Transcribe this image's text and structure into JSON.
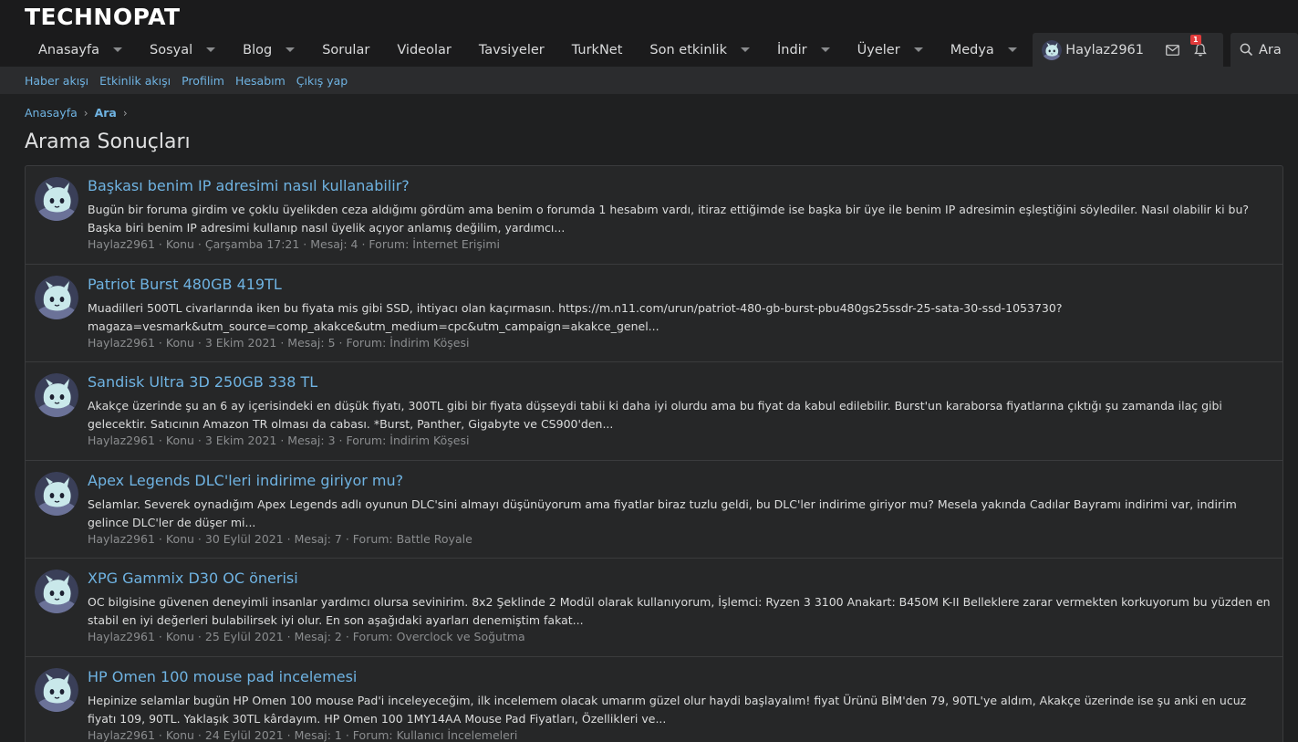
{
  "brand": {
    "logo_text": "TECHNOPAT"
  },
  "nav": {
    "items": [
      {
        "label": "Anasayfa",
        "dropdown": true
      },
      {
        "label": "Sosyal",
        "dropdown": true
      },
      {
        "label": "Blog",
        "dropdown": true
      },
      {
        "label": "Sorular",
        "dropdown": false
      },
      {
        "label": "Videolar",
        "dropdown": false
      },
      {
        "label": "Tavsiyeler",
        "dropdown": false
      },
      {
        "label": "TurkNet",
        "dropdown": false
      },
      {
        "label": "Son etkinlik",
        "dropdown": true
      },
      {
        "label": "İndir",
        "dropdown": true
      },
      {
        "label": "Üyeler",
        "dropdown": true
      },
      {
        "label": "Medya",
        "dropdown": true
      }
    ]
  },
  "account": {
    "username": "Haylaz2961",
    "notification_count": "1",
    "search_label": "Ara"
  },
  "subnav": {
    "items": [
      "Haber akışı",
      "Etkinlik akışı",
      "Profilim",
      "Hesabım",
      "Çıkış yap"
    ]
  },
  "breadcrumb": {
    "home": "Anasayfa",
    "current": "Ara"
  },
  "page": {
    "title": "Arama Sonuçları"
  },
  "results": [
    {
      "title": "Başkası benim IP adresimi nasıl kullanabilir?",
      "snippet": "Bugün bir foruma girdim ve çoklu üyelikden ceza aldığımı gördüm ama benim o forumda 1 hesabım vardı, itiraz ettiğimde ise başka bir üye ile benim IP adresimin eşleştiğini söylediler. Nasıl olabilir ki bu? Başka biri benim IP adresimi kullanıp nasıl üyelik açıyor anlamış değilim, yardımcı...",
      "meta": "Haylaz2961 · Konu · Çarşamba 17:21 · Mesaj: 4 · Forum: İnternet Erişimi"
    },
    {
      "title": "Patriot Burst 480GB 419TL",
      "snippet": "Muadilleri 500TL civarlarında iken bu fiyata mis gibi SSD, ihtiyacı olan kaçırmasın. https://m.n11.com/urun/patriot-480-gb-burst-pbu480gs25ssdr-25-sata-30-ssd-1053730?magaza=vesmark&utm_source=comp_akakce&utm_medium=cpc&utm_campaign=akakce_genel...",
      "meta": "Haylaz2961 · Konu · 3 Ekim 2021 · Mesaj: 5 · Forum: İndirim Köşesi"
    },
    {
      "title": "Sandisk Ultra 3D 250GB 338 TL",
      "snippet": "Akakçe üzerinde şu an 6 ay içerisindeki en düşük fiyatı, 300TL gibi bir fiyata düşseydi tabii ki daha iyi olurdu ama bu fiyat da kabul edilebilir. Burst'un karaborsa fiyatlarına çıktığı şu zamanda ilaç gibi gelecektir. Satıcının Amazon TR olması da cabası. *Burst, Panther, Gigabyte ve CS900'den...",
      "meta": "Haylaz2961 · Konu · 3 Ekim 2021 · Mesaj: 3 · Forum: İndirim Köşesi"
    },
    {
      "title": "Apex Legends DLC'leri indirime giriyor mu?",
      "snippet": "Selamlar. Severek oynadığım Apex Legends adlı oyunun DLC'sini almayı düşünüyorum ama fiyatlar biraz tuzlu geldi, bu DLC'ler indirime giriyor mu? Mesela yakında Cadılar Bayramı indirimi var, indirim gelince DLC'ler de düşer mi...",
      "meta": "Haylaz2961 · Konu · 30 Eylül 2021 · Mesaj: 7 · Forum: Battle Royale"
    },
    {
      "title": "XPG Gammix D30 OC önerisi",
      "snippet": "OC bilgisine güvenen deneyimli insanlar yardımcı olursa sevinirim. 8x2 Şeklinde 2 Modül olarak kullanıyorum, İşlemci: Ryzen 3 3100 Anakart: B450M K-II Belleklere zarar vermekten korkuyorum bu yüzden en stabil en iyi değerleri bulabilirsek iyi olur. En son aşağıdaki ayarları denemiştim fakat...",
      "meta": "Haylaz2961 · Konu · 25 Eylül 2021 · Mesaj: 2 · Forum: Overclock ve Soğutma"
    },
    {
      "title": "HP Omen 100 mouse pad incelemesi",
      "snippet": "Hepinize selamlar bugün HP Omen 100 mouse Pad'i inceleyeceğim, ilk incelemem olacak umarım güzel olur haydi başlayalım! fiyat Ürünü BİM'den 79, 90TL'ye aldım, Akakçe üzerinde ise şu anki en ucuz fiyatı 109, 90TL. Yaklaşık 30TL kârdayım. HP Omen 100 1MY14AA Mouse Pad Fiyatları, Özellikleri ve...",
      "meta": "Haylaz2961 · Konu · 24 Eylül 2021 · Mesaj: 1 · Forum: Kullanıcı İncelemeleri"
    }
  ]
}
